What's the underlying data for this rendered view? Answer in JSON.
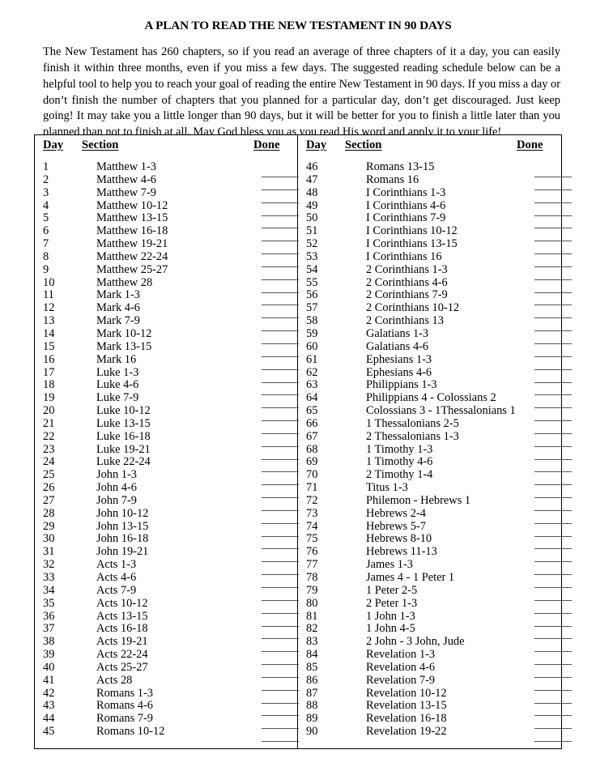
{
  "document": {
    "title": "A PLAN TO READ THE NEW TESTAMENT IN 90 DAYS",
    "intro": "The New Testament has 260 chapters, so if you read an average of three chapters of it a day, you can easily finish it within three months, even if you miss a few days.  The suggested reading schedule below can be a helpful tool to help you to reach your goal of reading the entire New Testament in 90 days.  If you miss a day or don’t finish the number of chapters that you planned for a particular day, don’t get discouraged.  Just keep going!  It may take you a little longer than 90 days, but it will be better for you to finish a little later than you planned than not to finish at all.  May God bless you as you read His word and apply it to your life!"
  },
  "table": {
    "headers": {
      "day": "Day",
      "section": "Section",
      "done": "Done"
    },
    "left_column": [
      {
        "day": "1",
        "section": "Matthew 1-3"
      },
      {
        "day": "2",
        "section": "Matthew 4-6"
      },
      {
        "day": "3",
        "section": "Matthew 7-9"
      },
      {
        "day": "4",
        "section": "Matthew 10-12"
      },
      {
        "day": "5",
        "section": "Matthew 13-15"
      },
      {
        "day": "6",
        "section": "Matthew 16-18"
      },
      {
        "day": "7",
        "section": "Matthew 19-21"
      },
      {
        "day": "8",
        "section": "Matthew 22-24"
      },
      {
        "day": "9",
        "section": "Matthew 25-27"
      },
      {
        "day": "10",
        "section": "Matthew 28"
      },
      {
        "day": "11",
        "section": "Mark 1-3"
      },
      {
        "day": "12",
        "section": "Mark 4-6"
      },
      {
        "day": "13",
        "section": "Mark 7-9"
      },
      {
        "day": "14",
        "section": "Mark 10-12"
      },
      {
        "day": "15",
        "section": "Mark 13-15"
      },
      {
        "day": "16",
        "section": "Mark 16"
      },
      {
        "day": "17",
        "section": "Luke 1-3"
      },
      {
        "day": "18",
        "section": "Luke 4-6"
      },
      {
        "day": "19",
        "section": "Luke 7-9"
      },
      {
        "day": "20",
        "section": "Luke 10-12"
      },
      {
        "day": "21",
        "section": "Luke 13-15"
      },
      {
        "day": "22",
        "section": "Luke 16-18"
      },
      {
        "day": "23",
        "section": "Luke 19-21"
      },
      {
        "day": "24",
        "section": "Luke 22-24"
      },
      {
        "day": "25",
        "section": "John 1-3"
      },
      {
        "day": "26",
        "section": "John 4-6"
      },
      {
        "day": "27",
        "section": "John 7-9"
      },
      {
        "day": "28",
        "section": "John 10-12"
      },
      {
        "day": "29",
        "section": "John 13-15"
      },
      {
        "day": "30",
        "section": "John 16-18"
      },
      {
        "day": "31",
        "section": "John 19-21"
      },
      {
        "day": "32",
        "section": "Acts 1-3"
      },
      {
        "day": "33",
        "section": "Acts 4-6"
      },
      {
        "day": "34",
        "section": "Acts 7-9"
      },
      {
        "day": "35",
        "section": "Acts 10-12"
      },
      {
        "day": "36",
        "section": "Acts 13-15"
      },
      {
        "day": "37",
        "section": "Acts 16-18"
      },
      {
        "day": "38",
        "section": "Acts 19-21"
      },
      {
        "day": "39",
        "section": "Acts 22-24"
      },
      {
        "day": "40",
        "section": "Acts 25-27"
      },
      {
        "day": "41",
        "section": "Acts 28"
      },
      {
        "day": "42",
        "section": "Romans 1-3"
      },
      {
        "day": "43",
        "section": "Romans 4-6"
      },
      {
        "day": "44",
        "section": "Romans 7-9"
      },
      {
        "day": "45",
        "section": "Romans 10-12"
      }
    ],
    "right_column": [
      {
        "day": "46",
        "section": "Romans 13-15"
      },
      {
        "day": "47",
        "section": "Romans 16"
      },
      {
        "day": "48",
        "section": "I Corinthians 1-3"
      },
      {
        "day": "49",
        "section": "I Corinthians 4-6"
      },
      {
        "day": "50",
        "section": "I Corinthians 7-9"
      },
      {
        "day": "51",
        "section": "I Corinthians 10-12"
      },
      {
        "day": "52",
        "section": "I Corinthians 13-15"
      },
      {
        "day": "53",
        "section": "I Corinthians 16"
      },
      {
        "day": "54",
        "section": "2 Corinthians 1-3"
      },
      {
        "day": "55",
        "section": "2 Corinthians 4-6"
      },
      {
        "day": "56",
        "section": "2 Corinthians 7-9"
      },
      {
        "day": "57",
        "section": "2 Corinthians 10-12"
      },
      {
        "day": "58",
        "section": "2 Corinthians 13"
      },
      {
        "day": "59",
        "section": "Galatians 1-3"
      },
      {
        "day": "60",
        "section": "Galatians 4-6"
      },
      {
        "day": "61",
        "section": "Ephesians 1-3"
      },
      {
        "day": "62",
        "section": "Ephesians 4-6"
      },
      {
        "day": "63",
        "section": "Philippians 1-3"
      },
      {
        "day": "64",
        "section": "Philippians 4 - Colossians 2"
      },
      {
        "day": "65",
        "section": "Colossians 3 - 1Thessalonians 1"
      },
      {
        "day": "66",
        "section": "1 Thessalonians 2-5"
      },
      {
        "day": "67",
        "section": "2 Thessalonians 1-3"
      },
      {
        "day": "68",
        "section": "1 Timothy 1-3"
      },
      {
        "day": "69",
        "section": "1 Timothy 4-6"
      },
      {
        "day": "70",
        "section": "2 Timothy 1-4"
      },
      {
        "day": "71",
        "section": "Titus 1-3"
      },
      {
        "day": "72",
        "section": "Philemon - Hebrews 1"
      },
      {
        "day": "73",
        "section": "Hebrews 2-4"
      },
      {
        "day": "74",
        "section": "Hebrews 5-7"
      },
      {
        "day": "75",
        "section": "Hebrews 8-10"
      },
      {
        "day": "76",
        "section": "Hebrews 11-13"
      },
      {
        "day": "77",
        "section": "James 1-3"
      },
      {
        "day": "78",
        "section": "James 4 - 1 Peter 1"
      },
      {
        "day": "79",
        "section": "1 Peter 2-5"
      },
      {
        "day": "80",
        "section": "2 Peter 1-3"
      },
      {
        "day": "81",
        "section": "1 John 1-3"
      },
      {
        "day": "82",
        "section": "1 John 4-5"
      },
      {
        "day": "83",
        "section": "2 John - 3 John, Jude"
      },
      {
        "day": "84",
        "section": "Revelation 1-3"
      },
      {
        "day": "85",
        "section": "Revelation 4-6"
      },
      {
        "day": "86",
        "section": "Revelation 7-9"
      },
      {
        "day": "87",
        "section": "Revelation 10-12"
      },
      {
        "day": "88",
        "section": "Revelation 13-15"
      },
      {
        "day": "89",
        "section": "Revelation 16-18"
      },
      {
        "day": "90",
        "section": "Revelation 19-22"
      }
    ]
  }
}
